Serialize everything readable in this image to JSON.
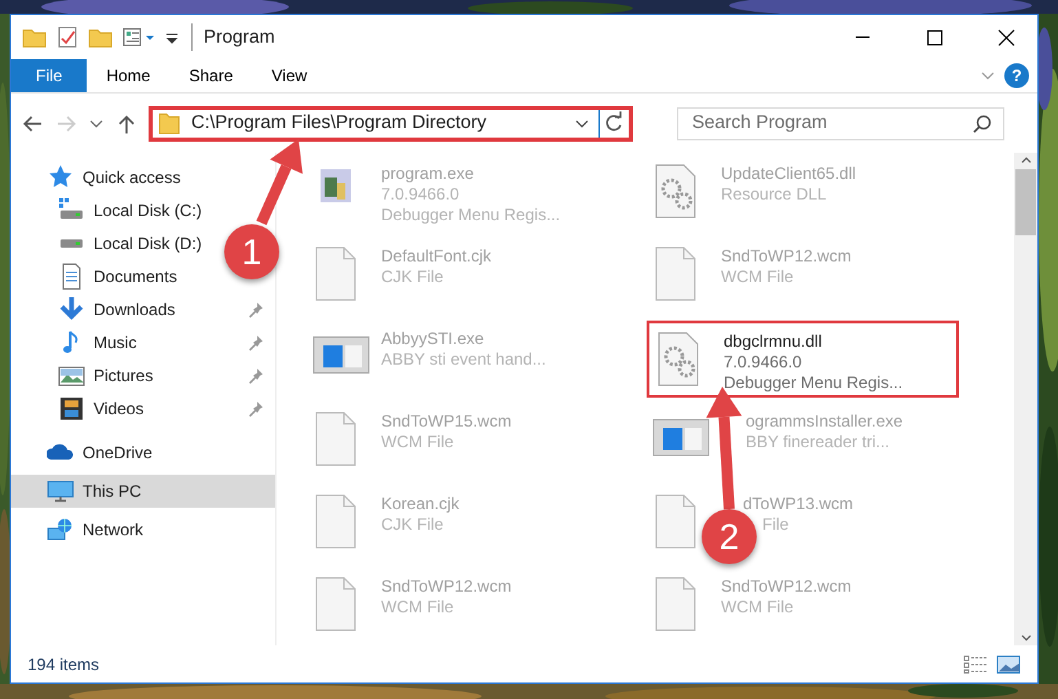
{
  "window": {
    "title": "Program"
  },
  "ribbon_tabs": [
    {
      "label": "File",
      "selected": true
    },
    {
      "label": "Home",
      "selected": false
    },
    {
      "label": "Share",
      "selected": false
    },
    {
      "label": "View",
      "selected": false
    }
  ],
  "help_button": "?",
  "address_bar": {
    "path": "C:\\Program Files\\Program Directory",
    "highlighted": true
  },
  "search": {
    "placeholder": "Search Program"
  },
  "sidebar": {
    "items": [
      {
        "label": "Quick access",
        "kind": "quick",
        "pinned": false,
        "selected": false
      },
      {
        "label": "Local Disk (C:)",
        "kind": "diskc",
        "pinned": false,
        "selected": false
      },
      {
        "label": "Local Disk (D:)",
        "kind": "disk",
        "pinned": false,
        "selected": false
      },
      {
        "label": "Documents",
        "kind": "documents",
        "pinned": false,
        "selected": false
      },
      {
        "label": "Downloads",
        "kind": "downloads",
        "pinned": true,
        "selected": false
      },
      {
        "label": "Music",
        "kind": "music",
        "pinned": true,
        "selected": false
      },
      {
        "label": "Pictures",
        "kind": "pictures",
        "pinned": true,
        "selected": false
      },
      {
        "label": "Videos",
        "kind": "videos",
        "pinned": true,
        "selected": false
      },
      {
        "label": "OneDrive",
        "kind": "onedrive",
        "pinned": false,
        "selected": false
      },
      {
        "label": "This PC",
        "kind": "pc",
        "pinned": false,
        "selected": true
      },
      {
        "label": "Network",
        "kind": "network",
        "pinned": false,
        "selected": false
      }
    ]
  },
  "files": [
    {
      "name": "program.exe",
      "details": [
        "7.0.9466.0",
        "Debugger Menu Regis..."
      ],
      "kind": "app",
      "highlighted": false
    },
    {
      "name": "UpdateClient65.dll",
      "details": [
        "Resource DLL"
      ],
      "kind": "dll",
      "highlighted": false
    },
    {
      "name": "DefaultFont.cjk",
      "details": [
        "CJK File"
      ],
      "kind": "doc",
      "highlighted": false
    },
    {
      "name": "SndToWP12.wcm",
      "details": [
        "WCM File"
      ],
      "kind": "doc",
      "highlighted": false
    },
    {
      "name": "AbbyySTI.exe",
      "details": [
        "ABBY sti event hand..."
      ],
      "kind": "window",
      "highlighted": false
    },
    {
      "name": "dbgclrmnu.dll",
      "details": [
        "7.0.9466.0",
        "Debugger Menu Regis..."
      ],
      "kind": "dll",
      "highlighted": true
    },
    {
      "name": "SndToWP15.wcm",
      "details": [
        "WCM File"
      ],
      "kind": "doc",
      "highlighted": false
    },
    {
      "name": "ogrammsInstaller.exe",
      "details": [
        "BBY finereader tri..."
      ],
      "kind": "window",
      "highlighted": false
    },
    {
      "name": "Korean.cjk",
      "details": [
        "CJK File"
      ],
      "kind": "doc",
      "highlighted": false
    },
    {
      "name": "dToWP13.wcm",
      "details": [
        "File"
      ],
      "kind": "doc",
      "highlighted": false
    },
    {
      "name": "SndToWP12.wcm",
      "details": [
        "WCM File"
      ],
      "kind": "doc",
      "highlighted": false
    },
    {
      "name": "SndToWP12.wcm",
      "details": [
        "WCM File"
      ],
      "kind": "doc",
      "highlighted": false
    }
  ],
  "status_bar": {
    "item_count": "194 items"
  },
  "annotations": [
    {
      "label": "1"
    },
    {
      "label": "2"
    }
  ]
}
